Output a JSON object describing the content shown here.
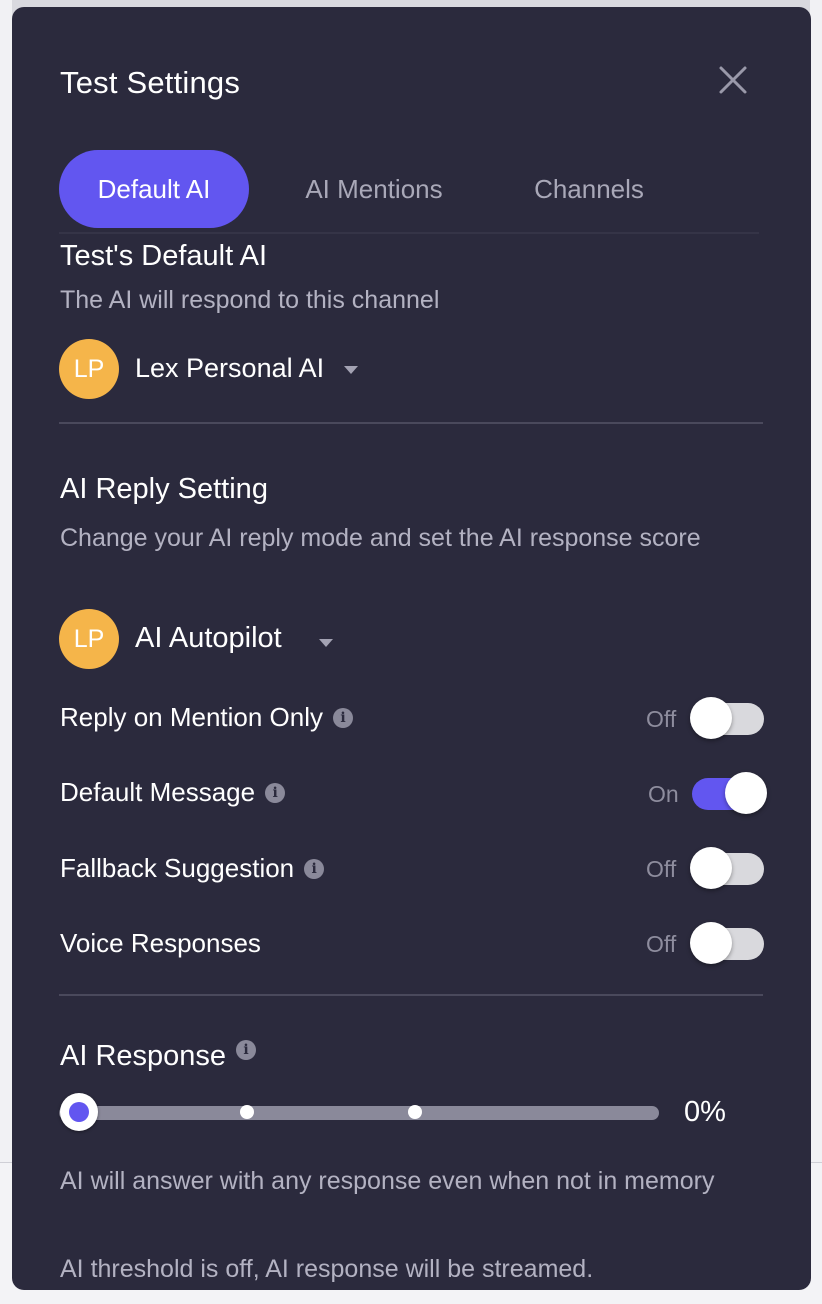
{
  "modal": {
    "title": "Test Settings"
  },
  "tabs": [
    {
      "label": "Default AI",
      "active": true
    },
    {
      "label": "AI Mentions",
      "active": false
    },
    {
      "label": "Channels",
      "active": false
    }
  ],
  "default_ai": {
    "title": "Test's Default AI",
    "subtitle": "The AI will respond to this channel",
    "avatar_initials": "LP",
    "selected": "Lex Personal AI"
  },
  "reply_setting": {
    "title": "AI Reply Setting",
    "subtitle": "Change your AI reply mode and set the AI response score",
    "avatar_initials": "LP",
    "selected": "AI Autopilot",
    "toggles": [
      {
        "label": "Reply on Mention Only",
        "state": "Off",
        "on": false,
        "info": true
      },
      {
        "label": "Default Message",
        "state": "On",
        "on": true,
        "info": true
      },
      {
        "label": "Fallback Suggestion",
        "state": "Off",
        "on": false,
        "info": true
      },
      {
        "label": "Voice Responses",
        "state": "Off",
        "on": false,
        "info": false
      }
    ]
  },
  "ai_response": {
    "title": "AI Response",
    "value": "0%",
    "value_fraction": 0,
    "note1": "AI will answer with any response even when not in memory",
    "note2": "AI threshold is off, AI response will be streamed."
  },
  "colors": {
    "modal_bg": "#2b2a3d",
    "accent": "#6256f0",
    "avatar": "#f5b54a"
  },
  "icons": [
    "close-icon",
    "info-icon",
    "caret-down-icon"
  ]
}
